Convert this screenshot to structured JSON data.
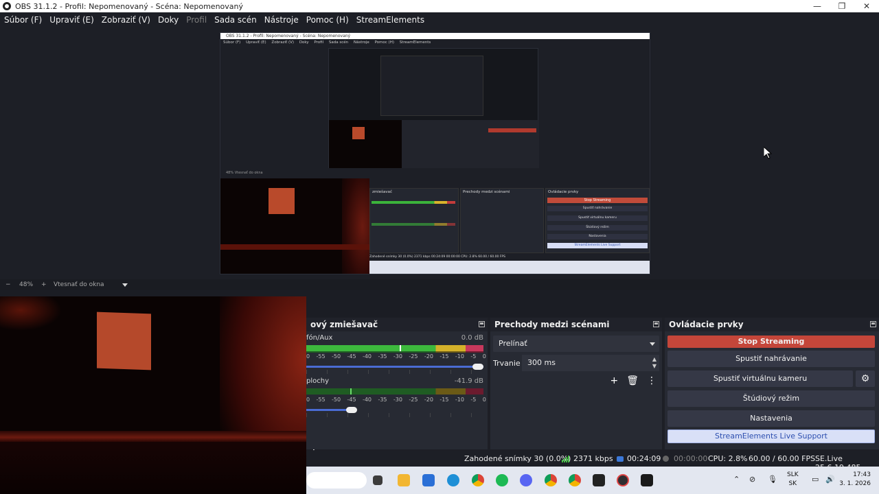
{
  "window": {
    "title": "OBS 31.1.2 - Profil: Nepomenovaný - Scéna: Nepomenovaný",
    "controls": [
      "—",
      "❐",
      "✕"
    ]
  },
  "menu": [
    {
      "label": "Súbor (F)",
      "enabled": true
    },
    {
      "label": "Upraviť (E)",
      "enabled": true
    },
    {
      "label": "Zobraziť (V)",
      "enabled": true
    },
    {
      "label": "Doky",
      "enabled": true
    },
    {
      "label": "Profil",
      "enabled": false
    },
    {
      "label": "Sada scén",
      "enabled": true
    },
    {
      "label": "Nástroje",
      "enabled": true
    },
    {
      "label": "Pomoc (H)",
      "enabled": true
    },
    {
      "label": "StreamElements",
      "enabled": true
    }
  ],
  "preview": {
    "mini_title": "OBS 31.1.2 - Profil: Nepomenovaný - Scéna: Nepomenovaný",
    "mini_menu": [
      "Súbor (F)",
      "Upraviť (E)",
      "Zobraziť (V)",
      "Doky",
      "Profil",
      "Sada scén",
      "Nástroje",
      "Pomoc (H)",
      "StreamElements"
    ],
    "mini_status": "48%   Vtesnať do okna",
    "mini_docks": {
      "mixer": "zmiešavač",
      "transitions": "Prechody medzi scénami",
      "controls": "Ovládacie prvky"
    },
    "mini_controls": [
      "Stop Streaming",
      "Spustiť nahrávanie",
      "Spustiť virtuálnu kameru",
      "Štúdiový režim",
      "Nastavenia",
      "StreamElements Live Support"
    ],
    "mini_statusbar": "Zahodené snímky 30 (0.0%)   2371 kbps   00:24:09   00:00:00   CPU: 2.8%   60.00 / 60.00 FPS"
  },
  "zoom": {
    "minus": "−",
    "percent": "48%",
    "plus": "+",
    "mode": "Vtesnať do okna"
  },
  "mixer": {
    "title": "ový zmiešavač",
    "tracks": [
      {
        "name": "fón/Aux",
        "db": "0.0 dB",
        "level": 0.75,
        "fader": 1.0
      },
      {
        "name": "plochy",
        "db": "-41.9 dB",
        "level": 0.24,
        "fader": 0.26
      }
    ],
    "scale": [
      "0",
      "-55",
      "-50",
      "-45",
      "-40",
      "-35",
      "-30",
      "-25",
      "-20",
      "-15",
      "-10",
      "-5",
      "0"
    ]
  },
  "transitions": {
    "title": "Prechody medzi scénami",
    "selected": "Prelínať",
    "duration_label": "Trvanie",
    "duration_value": "300 ms",
    "add": "+",
    "remove": "🗑",
    "more": "⋮"
  },
  "controls": {
    "title": "Ovládacie prvky",
    "stop_streaming": "Stop Streaming",
    "start_recording": "Spustiť nahrávanie",
    "start_virtual_cam": "Spustiť virtuálnu kameru",
    "studio_mode": "Štúdiový režim",
    "settings": "Nastavenia",
    "se_support": "StreamElements Live Support",
    "gear": "⚙"
  },
  "status": {
    "dropped": "Zahodené snímky 30 (0.0%)",
    "kbps": "2371 kbps",
    "live_time": "00:24:09",
    "rec_time": "00:00:00",
    "cpu": "CPU: 2.8%",
    "fps": "60.00 / 60.00 FPS",
    "se_version": "SE.Live 25.6.19.485"
  },
  "taskbar": {
    "lang_top": "SLK",
    "lang_bottom": "SK",
    "time": "17:43",
    "date": "3. 1. 2026",
    "tray_up": "⌃",
    "mixer_menu": "⋮"
  },
  "colors": {
    "accent_stop": "#c4463a",
    "se_button": "#d9e0f7",
    "meter_green": "#3db83d",
    "meter_yellow": "#d4b12a",
    "meter_red": "#c8385c",
    "fader_blue": "#4a6cd4"
  }
}
